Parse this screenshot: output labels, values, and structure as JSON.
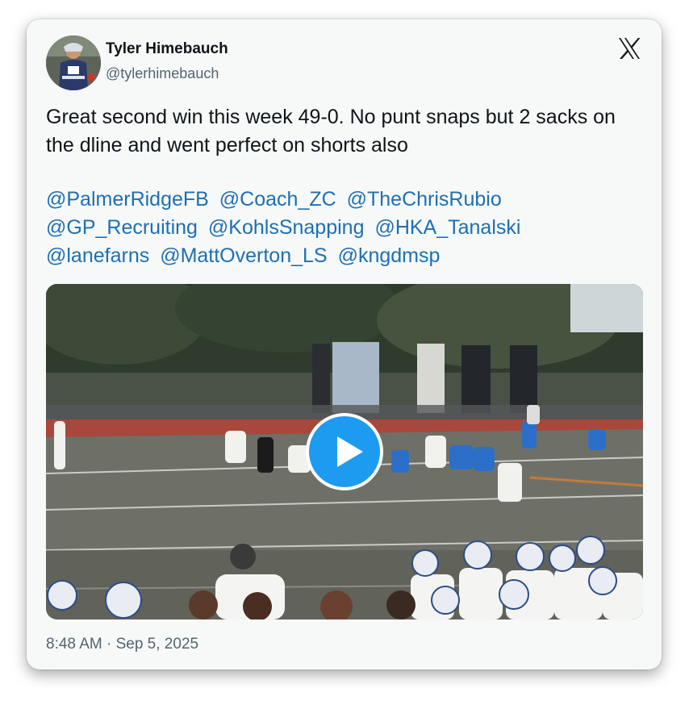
{
  "author": {
    "name": "Tyler Himebauch",
    "handle": "@tylerhimebauch"
  },
  "tweet": {
    "text": "Great second win this week 49-0. No punt snaps but 2 sacks on the dline and went perfect on shorts also",
    "mentions": [
      "@PalmerRidgeFB",
      "@Coach_ZC",
      "@TheChrisRubio",
      "@GP_Recruiting",
      "@KohlsSnapping",
      "@HKA_Tanalski",
      "@lanefarns",
      "@MattOverton_LS",
      "@kngdmsp"
    ],
    "timestamp": "8:48 AM · Sep 5, 2025"
  },
  "icons": {
    "logo": "x-logo-icon",
    "media_control": "play-icon"
  },
  "colors": {
    "link": "#1d6fb3",
    "play_button": "#1d9bf0",
    "card_background": "#f7f9f9"
  }
}
